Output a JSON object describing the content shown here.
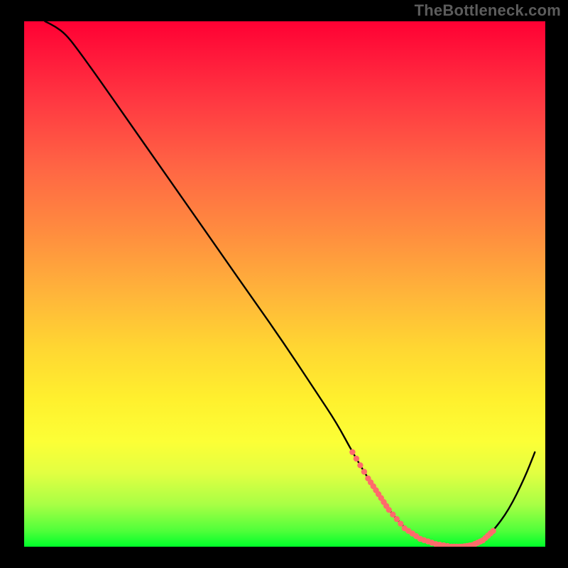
{
  "watermark": "TheBottleneck.com",
  "chart_data": {
    "type": "line",
    "title": "",
    "xlabel": "",
    "ylabel": "",
    "xlim": [
      0,
      100
    ],
    "ylim": [
      0,
      100
    ],
    "grid": false,
    "legend": false,
    "series": [
      {
        "name": "curve",
        "color": "#000000",
        "x": [
          4,
          6,
          8,
          10,
          14,
          20,
          26,
          32,
          38,
          44,
          50,
          56,
          60,
          63,
          66,
          68,
          70,
          73,
          76,
          79,
          82,
          84,
          86,
          88,
          90,
          93,
          96,
          98
        ],
        "y": [
          100,
          99,
          97.5,
          95,
          89.5,
          81,
          72.5,
          64,
          55.5,
          47,
          38.5,
          29.5,
          23.5,
          18,
          13,
          10,
          7,
          3.5,
          1.5,
          0.5,
          0,
          0,
          0.3,
          1.2,
          3,
          7,
          13,
          18
        ]
      }
    ],
    "dotted_region": {
      "color": "#ff6b6b",
      "x": [
        63,
        66,
        68,
        70,
        73,
        76,
        79,
        82,
        84,
        86,
        88,
        90
      ],
      "y": [
        18,
        13,
        10,
        7,
        3.5,
        1.5,
        0.5,
        0,
        0,
        0.3,
        1.2,
        3
      ]
    },
    "gradient_stops": [
      {
        "pct": 0,
        "color": "#ff0033"
      },
      {
        "pct": 40,
        "color": "#ff8c3f"
      },
      {
        "pct": 72,
        "color": "#fff02e"
      },
      {
        "pct": 100,
        "color": "#00ff2a"
      }
    ]
  }
}
